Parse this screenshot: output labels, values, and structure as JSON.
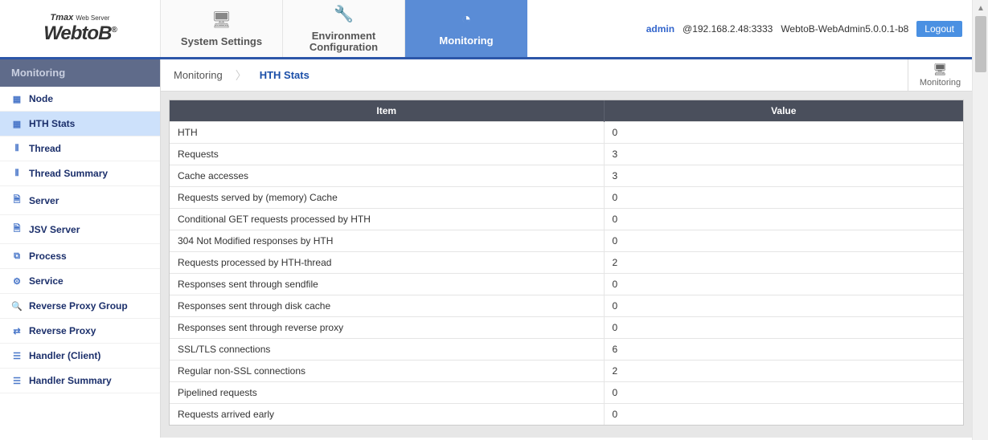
{
  "header": {
    "logo_line1_brand": "Tmax",
    "logo_line1_sub": "Web Server",
    "logo_line2": "WebtoB",
    "logo_reg": "®",
    "nav": [
      {
        "label": "System Settings",
        "icon": "🖥"
      },
      {
        "label": "Environment\nConfiguration",
        "icon": "🔧"
      },
      {
        "label": "Monitoring",
        "icon": "◔"
      }
    ],
    "user": "admin",
    "address": "@192.168.2.48:3333",
    "version": "WebtoB-WebAdmin5.0.0.1-b8",
    "logout": "Logout"
  },
  "sidebar": {
    "title": "Monitoring",
    "items": [
      {
        "label": "Node",
        "icon": "▦"
      },
      {
        "label": "HTH Stats",
        "icon": "▦"
      },
      {
        "label": "Thread",
        "icon": "⦀"
      },
      {
        "label": "Thread Summary",
        "icon": "⦀"
      },
      {
        "label": "Server",
        "icon": "🗎"
      },
      {
        "label": "JSV Server",
        "icon": "🗎"
      },
      {
        "label": "Process",
        "icon": "⧉"
      },
      {
        "label": "Service",
        "icon": "⚙"
      },
      {
        "label": "Reverse Proxy Group",
        "icon": "🔍"
      },
      {
        "label": "Reverse Proxy",
        "icon": "⇄"
      },
      {
        "label": "Handler (Client)",
        "icon": "☰"
      },
      {
        "label": "Handler Summary",
        "icon": "☰"
      }
    ]
  },
  "breadcrumb": {
    "level1": "Monitoring",
    "level2": "HTH Stats",
    "badge": "Monitoring"
  },
  "table": {
    "columns": [
      "Item",
      "Value"
    ],
    "rows": [
      {
        "item": "HTH",
        "value": "0"
      },
      {
        "item": "Requests",
        "value": "3"
      },
      {
        "item": "Cache accesses",
        "value": "3"
      },
      {
        "item": "Requests served by (memory) Cache",
        "value": "0"
      },
      {
        "item": "Conditional GET requests processed by HTH",
        "value": "0"
      },
      {
        "item": "304 Not Modified responses by HTH",
        "value": "0"
      },
      {
        "item": "Requests processed by HTH-thread",
        "value": "2"
      },
      {
        "item": "Responses sent through sendfile",
        "value": "0"
      },
      {
        "item": "Responses sent through disk cache",
        "value": "0"
      },
      {
        "item": "Responses sent through reverse proxy",
        "value": "0"
      },
      {
        "item": "SSL/TLS connections",
        "value": "6"
      },
      {
        "item": "Regular non-SSL connections",
        "value": "2"
      },
      {
        "item": "Pipelined requests",
        "value": "0"
      },
      {
        "item": "Requests arrived early",
        "value": "0"
      }
    ]
  }
}
